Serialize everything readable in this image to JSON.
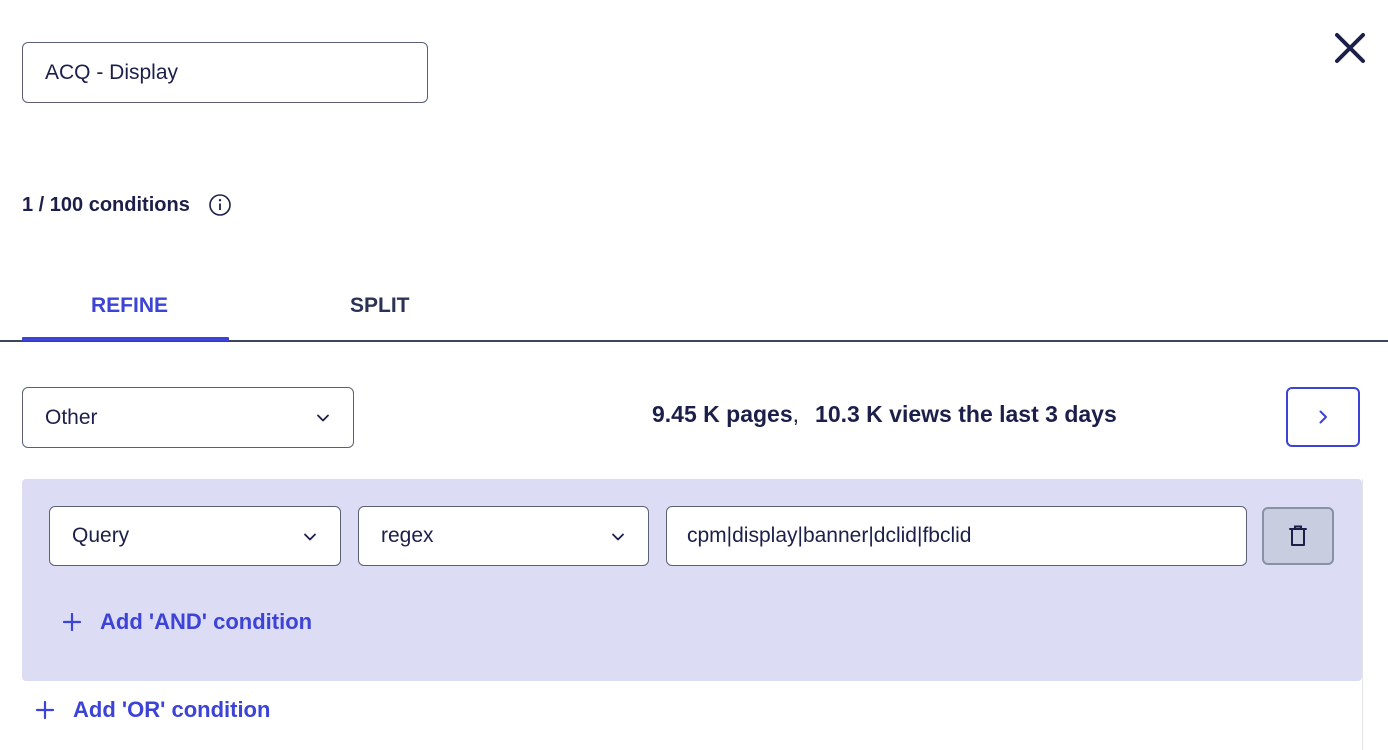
{
  "segment": {
    "name_value": "ACQ - Display"
  },
  "conditions": {
    "count_label": "1 / 100 conditions"
  },
  "tabs": [
    {
      "label": "REFINE",
      "active": true
    },
    {
      "label": "SPLIT",
      "active": false
    }
  ],
  "filter": {
    "category_selected": "Other"
  },
  "stats": {
    "pages": "9.45 K pages",
    "separator": ",",
    "views": "10.3 K views the last 3 days"
  },
  "condition_group": {
    "field_selected": "Query",
    "operator_selected": "regex",
    "value": "cpm|display|banner|dclid|fbclid",
    "add_and_label": "Add 'AND' condition"
  },
  "add_or_label": "Add 'OR' condition",
  "colors": {
    "accent": "#3c43d6",
    "text": "#1c1f4a",
    "group_bg": "#dcdcf5"
  },
  "icons": {
    "close": "close-icon",
    "info": "info-icon",
    "chevron": "chevron-down-icon",
    "next": "chevron-right-icon",
    "delete": "trash-icon",
    "plus": "plus-icon"
  }
}
